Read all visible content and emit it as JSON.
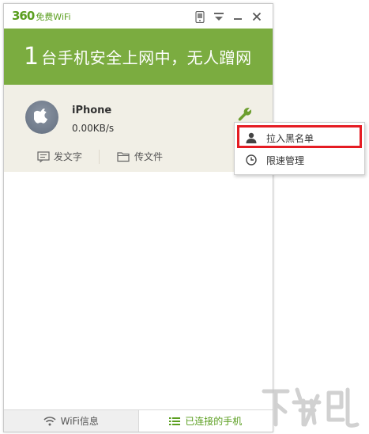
{
  "app": {
    "logo_number": "360",
    "logo_text": "免费WiFi"
  },
  "banner": {
    "count": "1",
    "text": "台手机安全上网中，无人蹭网"
  },
  "device": {
    "name": "iPhone",
    "speed": "0.00KB/s",
    "actions": {
      "send_text": "发文字",
      "send_file": "传文件"
    }
  },
  "context_menu": {
    "items": [
      "拉入黑名单",
      "限速管理"
    ]
  },
  "tabs": {
    "wifi_info": "WiFi信息",
    "connected_phones": "已连接的手机"
  },
  "colors": {
    "accent_green": "#7bac40",
    "highlight_red": "#e51c23"
  },
  "watermark": {
    "text": "下载吧"
  }
}
